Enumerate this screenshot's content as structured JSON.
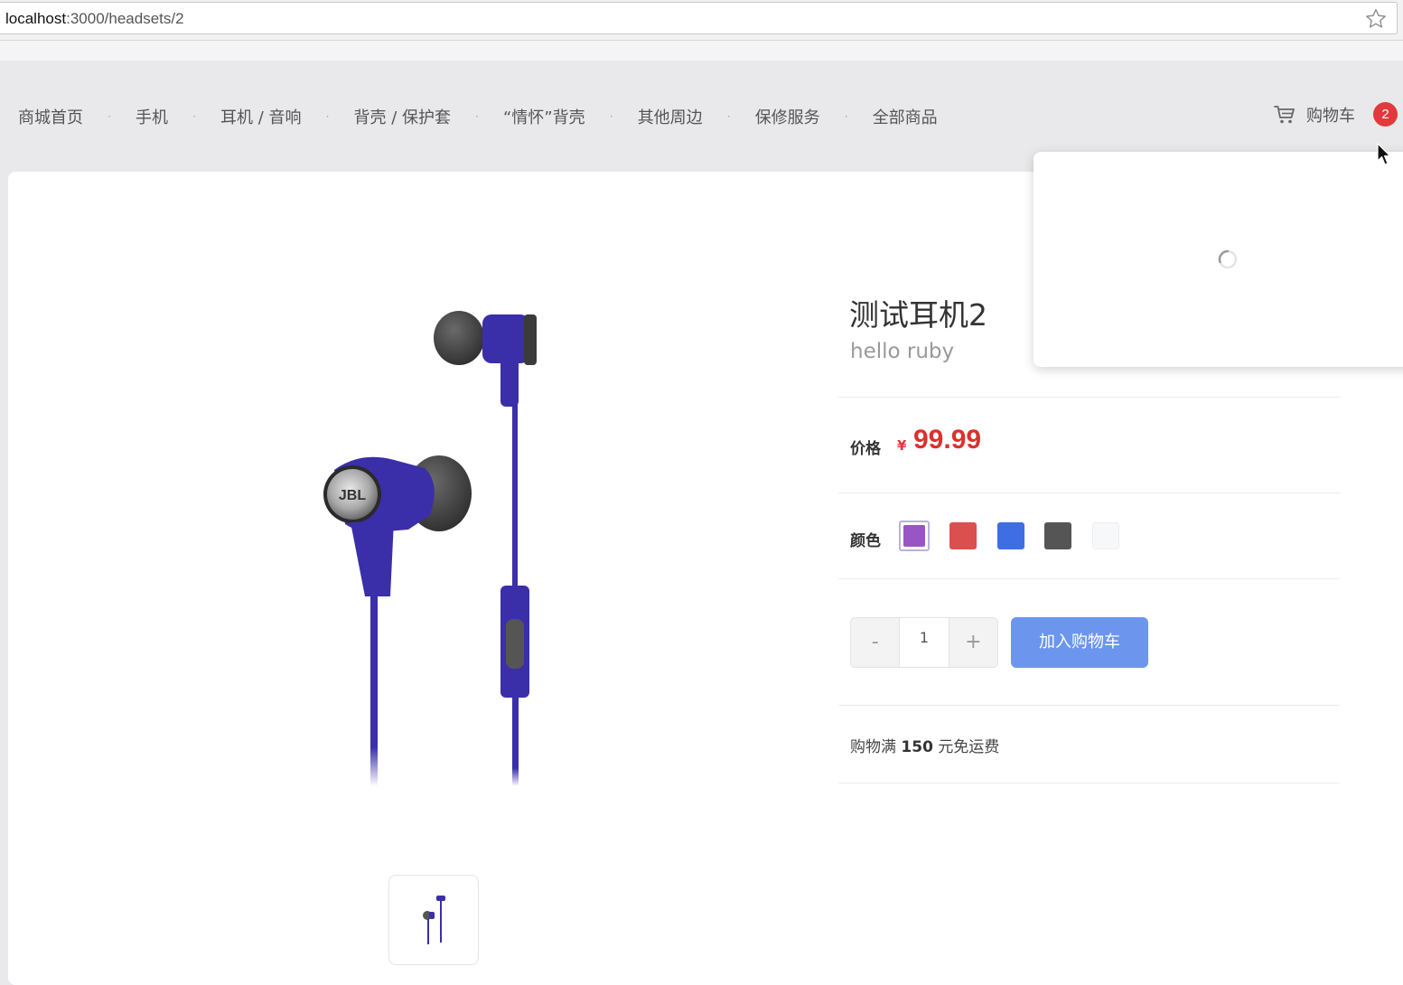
{
  "browser": {
    "url_host": "localhost",
    "url_path": ":3000/headsets/2"
  },
  "nav": {
    "items": [
      "商城首页",
      "手机",
      "耳机 / 音响",
      "背壳 / 保护套",
      "“情怀”背壳",
      "其他周边",
      "保修服务",
      "全部商品"
    ],
    "separator": "·",
    "cart_label": "购物车",
    "cart_count": "2"
  },
  "product": {
    "title": "测试耳机2",
    "subtitle": "hello ruby",
    "price_label": "价格",
    "currency": "¥",
    "price": "99.99",
    "color_label": "颜色",
    "colors": [
      "#9a55c4",
      "#db4f4f",
      "#3f6de3",
      "#555555",
      "#f7f8fa"
    ],
    "selected_color_index": 0,
    "quantity": "1",
    "minus_label": "-",
    "plus_label": "+",
    "add_to_cart_label": "加入购物车",
    "shipping_prefix": "购物满",
    "shipping_amount": "150",
    "shipping_suffix": "元免运费"
  },
  "colors": {
    "accent_blue": "#6c95ed",
    "price_red": "#d9322f",
    "badge_red": "#e2393c"
  }
}
